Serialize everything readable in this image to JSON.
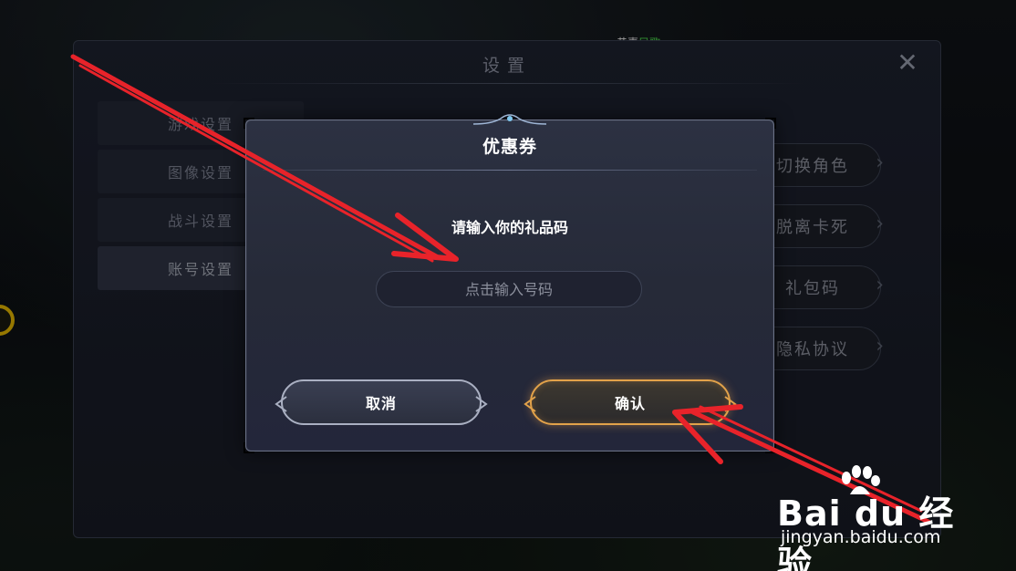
{
  "notice": {
    "prefix": "恭喜",
    "highlight": "凤歌"
  },
  "settings": {
    "title": "设置",
    "close_icon": "close-icon",
    "side_menu": [
      {
        "label": "游戏设置",
        "active": false
      },
      {
        "label": "图像设置",
        "active": false
      },
      {
        "label": "战斗设置",
        "active": false
      },
      {
        "label": "账号设置",
        "active": true
      }
    ],
    "right_items": [
      {
        "label": "切换角色"
      },
      {
        "label": "脱离卡死"
      },
      {
        "label": "礼包码"
      },
      {
        "label": "隐私协议"
      }
    ]
  },
  "modal": {
    "title": "优惠券",
    "prompt": "请输入你的礼品码",
    "input": {
      "value": "",
      "placeholder": "点击输入号码"
    },
    "cancel_label": "取消",
    "confirm_label": "确认"
  },
  "watermark": {
    "brand": "Bai du 经验",
    "url": "jingyan.baidu.com"
  },
  "colors": {
    "annotation_arrow": "#e8232a",
    "confirm_border": "#e2a24a",
    "notice_highlight": "#4ee04e"
  }
}
